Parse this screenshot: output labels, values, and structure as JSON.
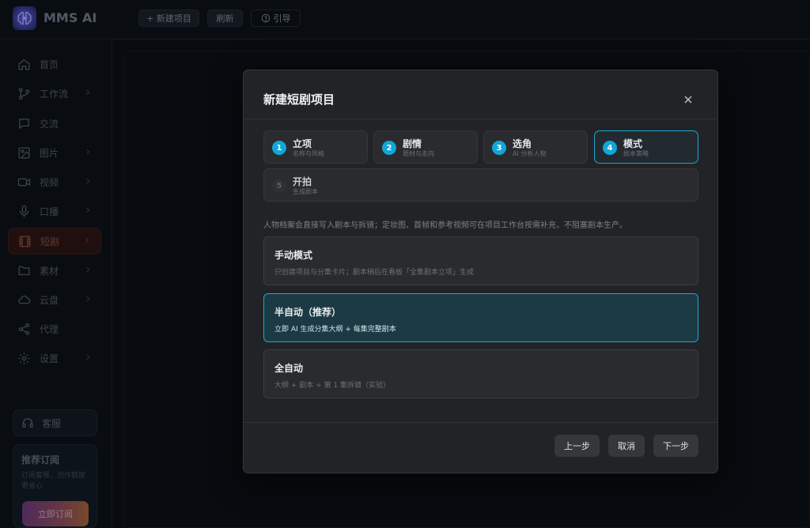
{
  "app": {
    "brand": "MMS AI"
  },
  "toolbar": {
    "new_project": "+ 新建项目",
    "refresh": "刷新",
    "guide": "引导"
  },
  "sidebar": {
    "items": [
      {
        "label": "首页",
        "icon": "home-icon"
      },
      {
        "label": "工作流",
        "icon": "workflow-icon"
      },
      {
        "label": "交流",
        "icon": "chat-icon"
      },
      {
        "label": "图片",
        "icon": "image-icon"
      },
      {
        "label": "视频",
        "icon": "video-icon"
      },
      {
        "label": "口播",
        "icon": "microphone-icon"
      },
      {
        "label": "短剧",
        "icon": "film-icon"
      },
      {
        "label": "素材",
        "icon": "folder-icon"
      },
      {
        "label": "云盘",
        "icon": "cloud-icon"
      },
      {
        "label": "代理",
        "icon": "share-icon"
      },
      {
        "label": "设置",
        "icon": "gear-icon"
      }
    ],
    "service": "客服",
    "promo": {
      "title": "推荐订阅",
      "desc": "订阅套餐，创作额度更省心",
      "button": "立即订阅"
    }
  },
  "modal": {
    "title": "新建短剧项目",
    "steps": [
      {
        "num": "1",
        "label": "立项",
        "sub": "名称与风格"
      },
      {
        "num": "2",
        "label": "剧情",
        "sub": "题材与走向"
      },
      {
        "num": "3",
        "label": "选角",
        "sub": "AI 分析人物"
      },
      {
        "num": "4",
        "label": "模式",
        "sub": "剧本策略"
      },
      {
        "num": "5",
        "label": "开拍",
        "sub": "生成剧本"
      }
    ],
    "note": "人物档案会直接写入剧本与拆镜；定妆图、首帧和参考视频可在项目工作台按需补充，不阻塞剧本生产。",
    "options": [
      {
        "title": "手动模式",
        "desc": "只创建项目与分集卡片；剧本稍后在看板「全集剧本立项」生成"
      },
      {
        "title": "半自动（推荐）",
        "desc": "立即 AI 生成分集大纲 + 每集完整剧本"
      },
      {
        "title": "全自动",
        "desc": "大纲 + 剧本 + 第 1 集拆镜（实验）"
      }
    ],
    "selected_option": "半自动（推荐）",
    "active_step": "4",
    "buttons": {
      "prev": "上一步",
      "cancel": "取消",
      "next": "下一步"
    }
  }
}
